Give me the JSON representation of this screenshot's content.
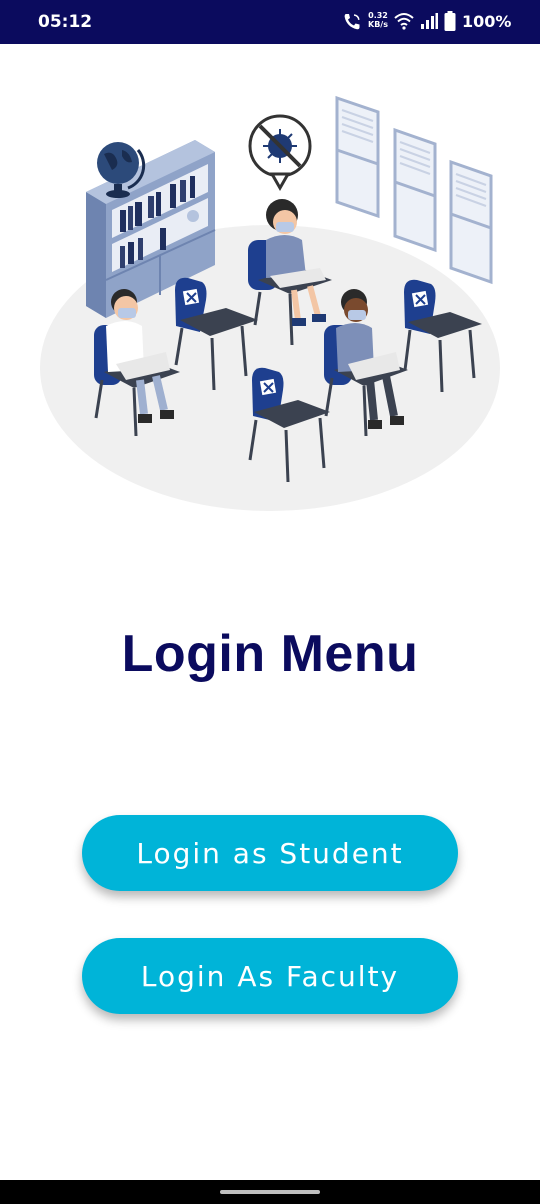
{
  "status_bar": {
    "time": "05:12",
    "net_speed_value": "0.32",
    "net_speed_unit": "KB/s",
    "battery_percent": "100%",
    "icons": [
      "call-icon",
      "wifi-icon",
      "signal-icon",
      "battery-icon"
    ]
  },
  "illustration": {
    "description_icon": "classroom-illustration"
  },
  "main": {
    "title": "Login Menu",
    "buttons": {
      "student": "Login as Student",
      "faculty": "Login As Faculty"
    }
  },
  "colors": {
    "status_bar": "#0b0b5e",
    "title": "#0b0b5e",
    "button": "#00b4d8",
    "button_text": "#ffffff"
  }
}
